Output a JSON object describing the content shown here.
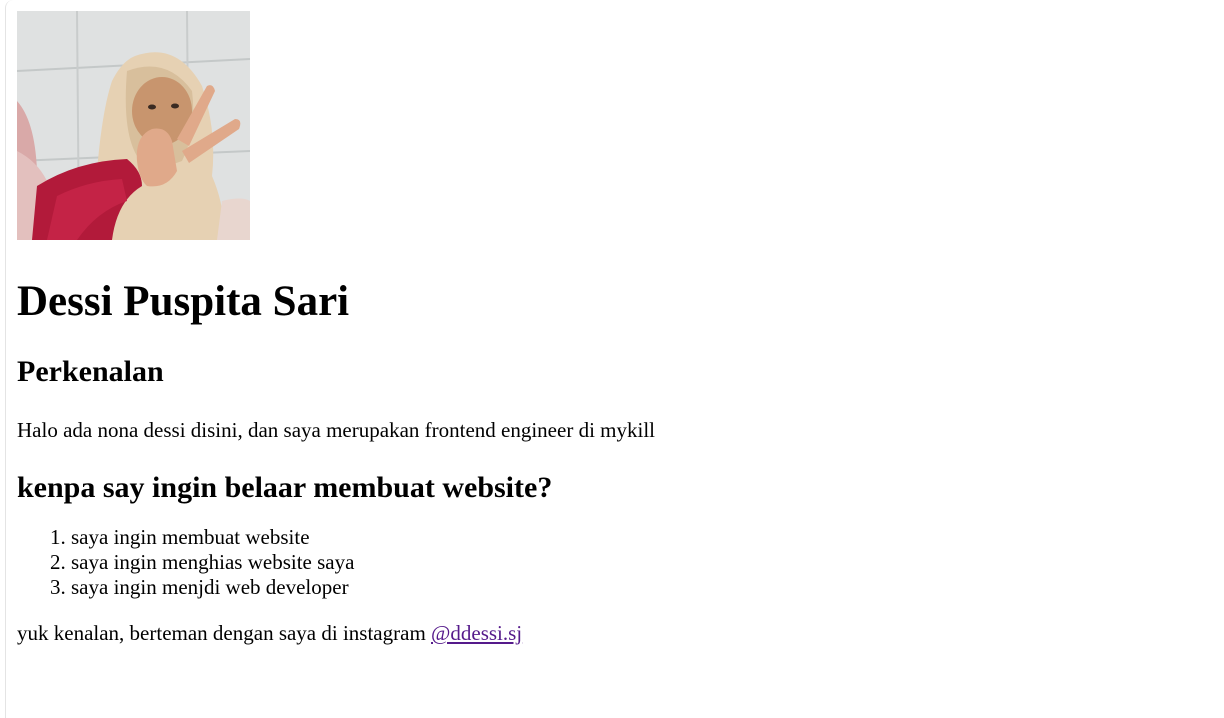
{
  "profile": {
    "name": "Dessi Puspita Sari",
    "photo_alt": "photo",
    "intro_heading": "Perkenalan",
    "bio": "Halo ada nona dessi disini, dan saya merupakan frontend engineer di mykill"
  },
  "reasons": {
    "heading": "kenpa say ingin belaar membuat website?",
    "items": [
      "saya ingin membuat website",
      "saya ingin menghias website saya",
      "saya ingin menjdi web developer"
    ]
  },
  "contact": {
    "text": "yuk kenalan, berteman dengan saya di instagram ",
    "instagram_handle": "@ddessi.sj"
  },
  "colors": {
    "visited_link": "#551a8b",
    "background": "#ffffff"
  }
}
